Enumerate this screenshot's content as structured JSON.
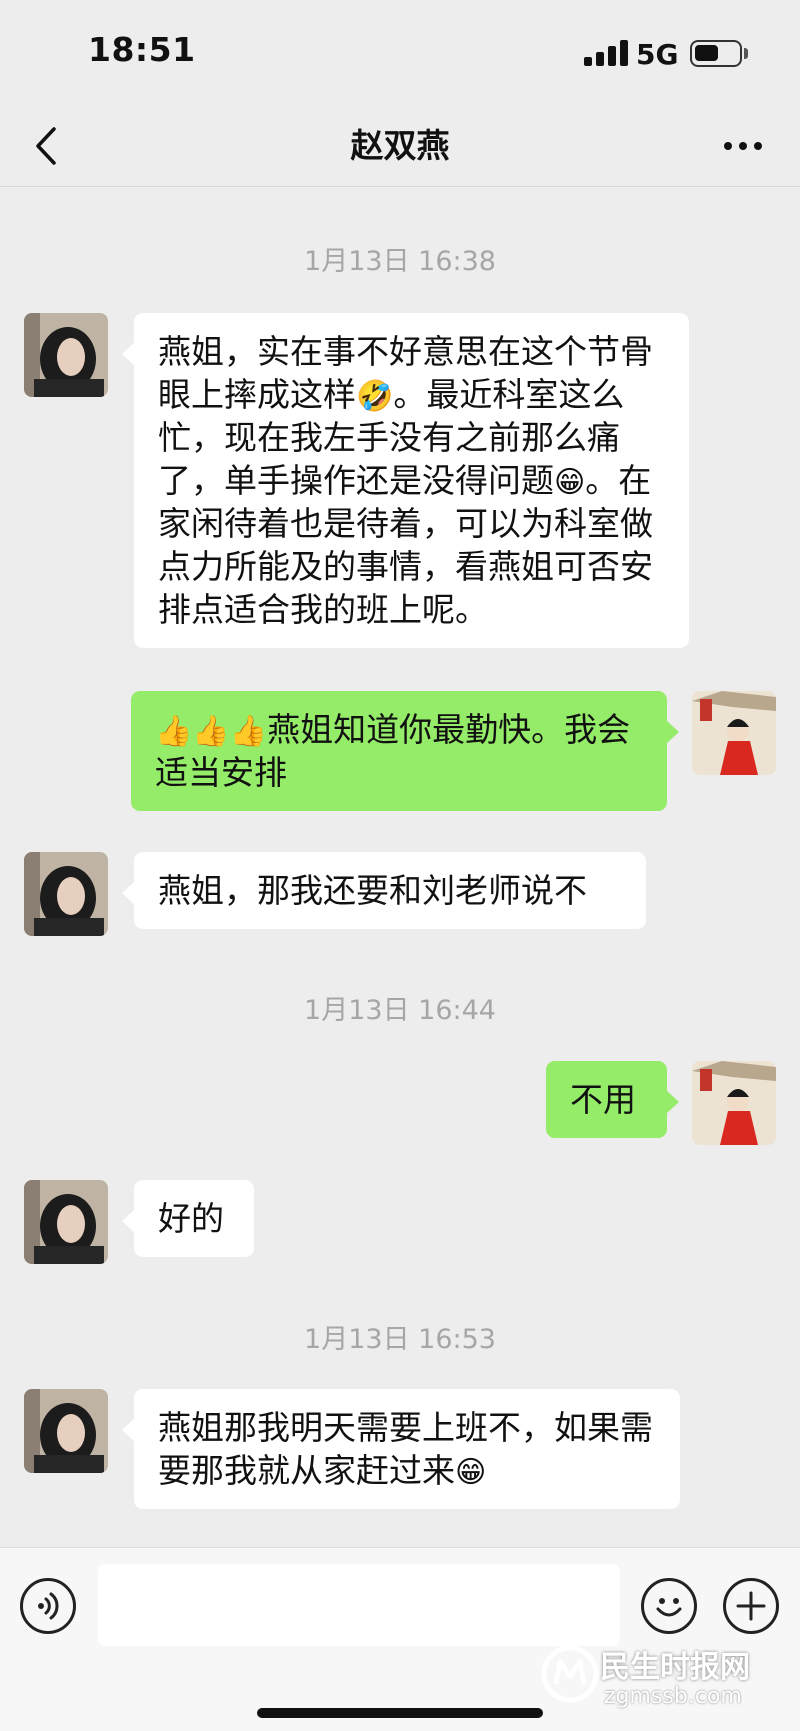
{
  "status_bar": {
    "time": "18:51",
    "network": "5G",
    "battery_level": 0.55
  },
  "nav": {
    "title": "赵双燕"
  },
  "timestamps": [
    "1月13日 16:38",
    "1月13日 16:44",
    "1月13日 16:53"
  ],
  "messages": [
    {
      "from": "contact",
      "text": "燕姐，实在事不好意思在这个节骨眼上摔成这样",
      "emoji_1": "🤣",
      "text_2": "。最近科室这么忙，现在我左手没有之前那么痛了，单手操作还是没得问题",
      "emoji_2": "😁",
      "text_3": "。在家闲待着也是待着，可以为科室做点力所能及的事情，看燕姐可否安排点适合我的班上呢。"
    },
    {
      "from": "me",
      "emoji_1": "👍👍👍",
      "text": "燕姐知道你最勤快。我会适当安排"
    },
    {
      "from": "contact",
      "text": "燕姐，那我还要和刘老师说不"
    },
    {
      "from": "me",
      "text": "不用"
    },
    {
      "from": "contact",
      "text": "好的"
    },
    {
      "from": "contact",
      "text": "燕姐那我明天需要上班不，如果需要那我就从家赶过来",
      "emoji_1": "😁"
    }
  ],
  "input_bar": {
    "placeholder": ""
  },
  "icons": {
    "back": "chevron-left-icon",
    "more": "more-dots-icon",
    "voice": "voice-icon",
    "emoji": "smiley-icon",
    "add": "plus-icon"
  },
  "watermark": {
    "text": "民生时报网",
    "url": "zgmssb.com"
  },
  "colors": {
    "background": "#ededed",
    "incoming_bubble": "#ffffff",
    "outgoing_bubble": "#95ec69",
    "timestamp": "#a6a6a6"
  }
}
